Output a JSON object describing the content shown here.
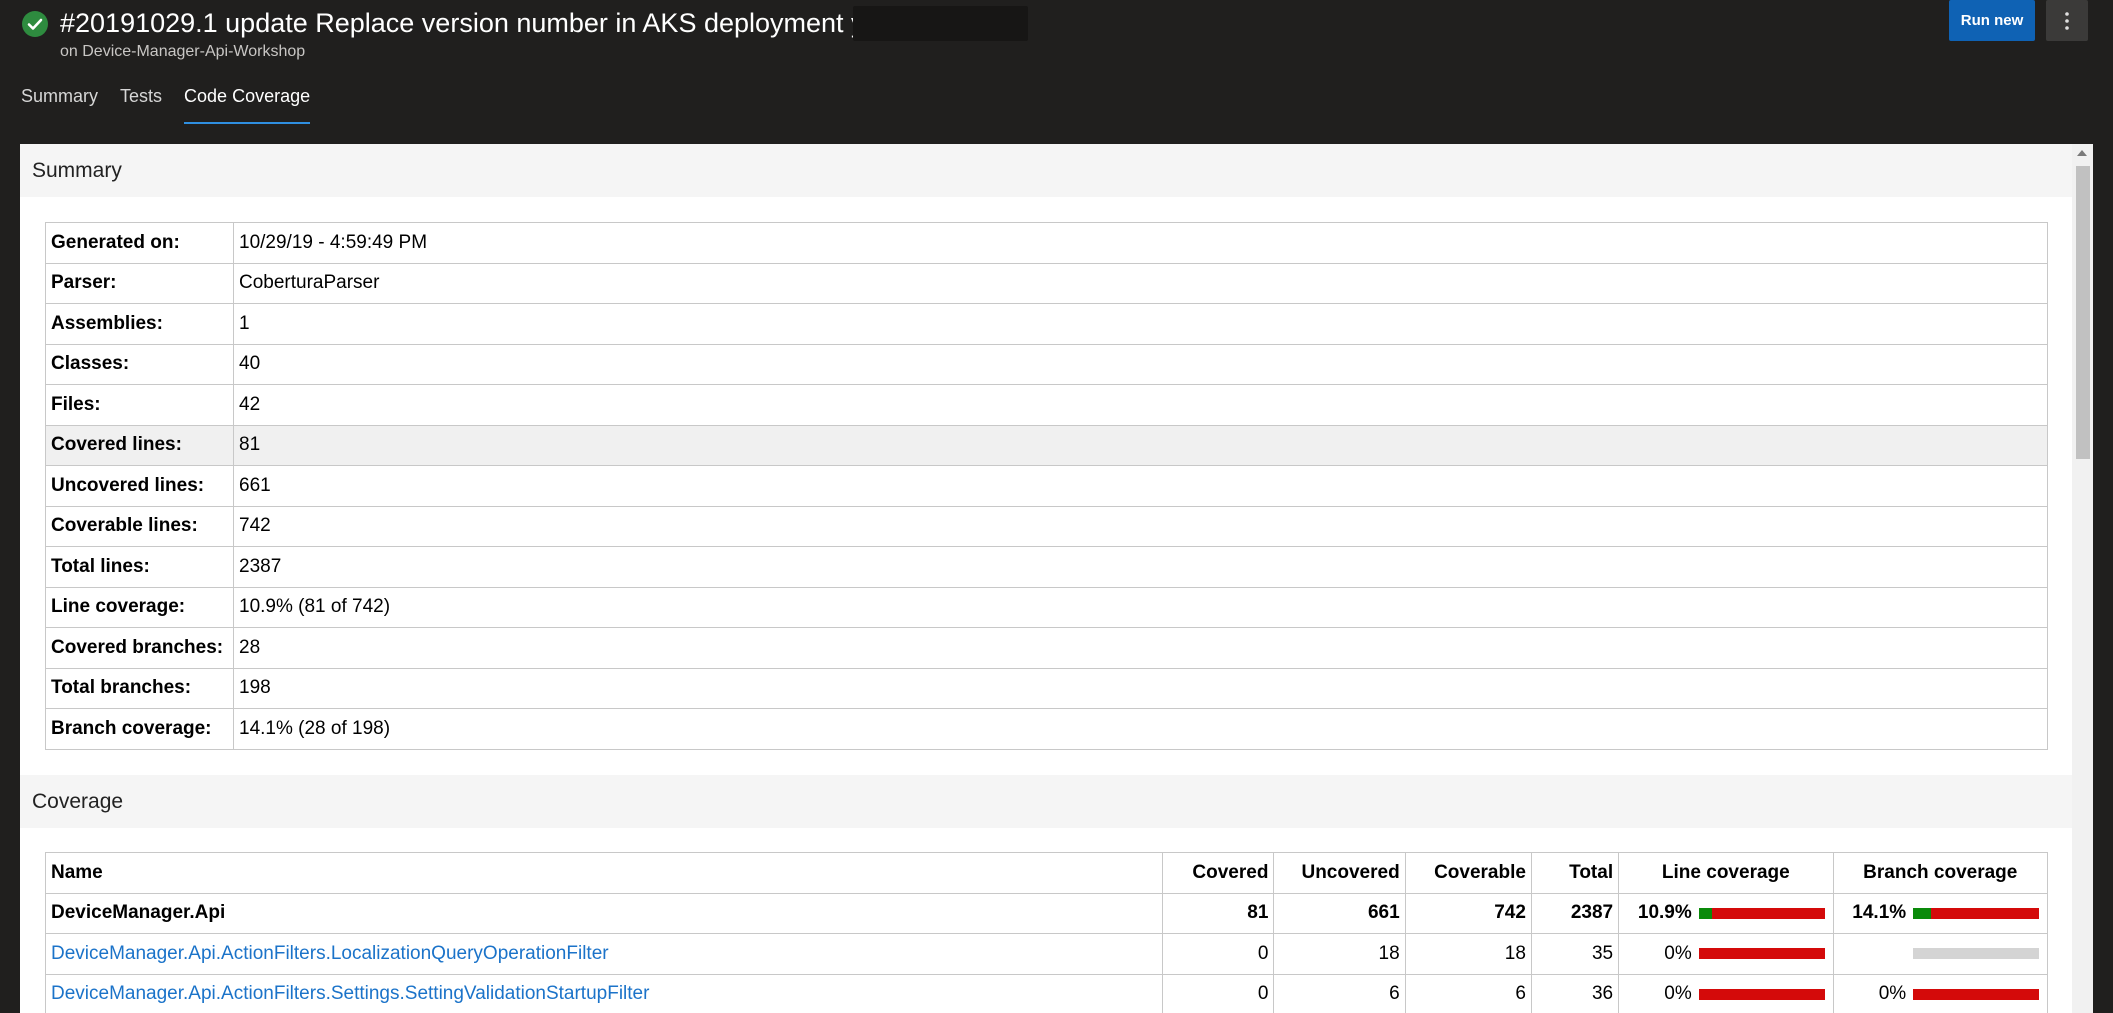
{
  "header": {
    "title": "#20191029.1 update Replace version number in AKS deployment yaml",
    "subtitle": "on Device-Manager-Api-Workshop",
    "run_new_label": "Run new",
    "more_label": "⋮",
    "status_color": "#2e8b3f"
  },
  "tabs": [
    {
      "label": "Summary",
      "active": false
    },
    {
      "label": "Tests",
      "active": false
    },
    {
      "label": "Code Coverage",
      "active": true
    }
  ],
  "summary": {
    "title": "Summary",
    "rows": [
      {
        "key": "Generated on:",
        "value": "10/29/19 - 4:59:49 PM"
      },
      {
        "key": "Parser:",
        "value": "CoberturaParser"
      },
      {
        "key": "Assemblies:",
        "value": "1"
      },
      {
        "key": "Classes:",
        "value": "40"
      },
      {
        "key": "Files:",
        "value": "42"
      },
      {
        "key": "Covered lines:",
        "value": "81"
      },
      {
        "key": "Uncovered lines:",
        "value": "661"
      },
      {
        "key": "Coverable lines:",
        "value": "742"
      },
      {
        "key": "Total lines:",
        "value": "2387"
      },
      {
        "key": "Line coverage:",
        "value": "10.9% (81 of 742)"
      },
      {
        "key": "Covered branches:",
        "value": "28"
      },
      {
        "key": "Total branches:",
        "value": "198"
      },
      {
        "key": "Branch coverage:",
        "value": "14.1% (28 of 198)"
      }
    ]
  },
  "coverage": {
    "title": "Coverage",
    "headers": {
      "name": "Name",
      "covered": "Covered",
      "uncovered": "Uncovered",
      "coverable": "Coverable",
      "total": "Total",
      "line_coverage": "Line coverage",
      "branch_coverage": "Branch coverage"
    },
    "rows": [
      {
        "name": "DeviceManager.Api",
        "covered": "81",
        "uncovered": "661",
        "coverable": "742",
        "total": "2387",
        "line_pct": "10.9%",
        "line_fraction": 0.109,
        "branch_pct": "14.1%",
        "branch_fraction": 0.141,
        "branch_available": true
      },
      {
        "name": "DeviceManager.Api.ActionFilters.LocalizationQueryOperationFilter",
        "covered": "0",
        "uncovered": "18",
        "coverable": "18",
        "total": "35",
        "line_pct": "0%",
        "line_fraction": 0,
        "branch_pct": "",
        "branch_fraction": 0,
        "branch_available": false
      },
      {
        "name": "DeviceManager.Api.ActionFilters.Settings.SettingValidationStartupFilter",
        "covered": "0",
        "uncovered": "6",
        "coverable": "6",
        "total": "36",
        "line_pct": "0%",
        "line_fraction": 0,
        "branch_pct": "0%",
        "branch_fraction": 0,
        "branch_available": true
      }
    ]
  }
}
